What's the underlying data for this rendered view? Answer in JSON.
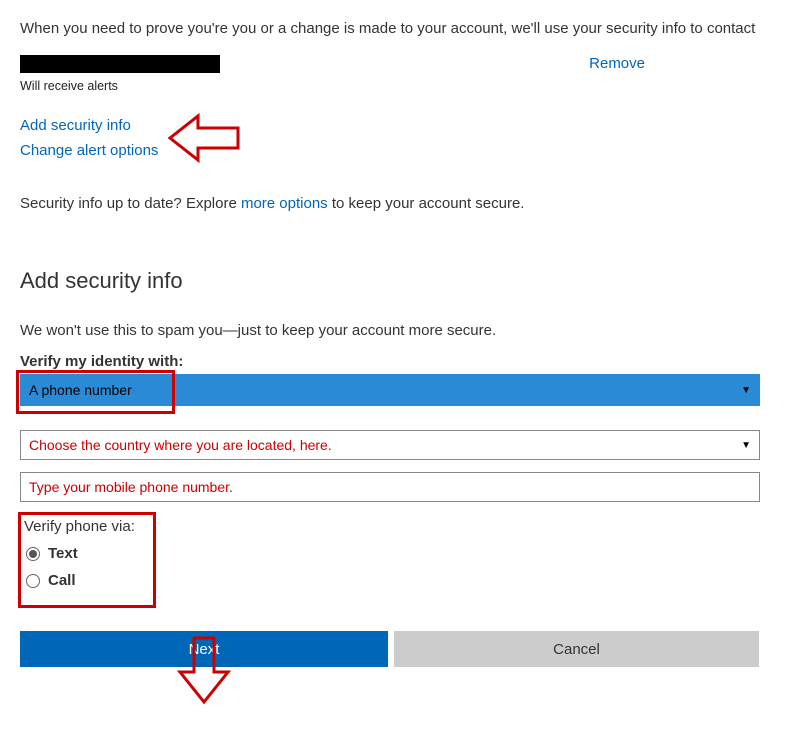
{
  "intro": "When you need to prove you're you or a change is made to your account, we'll use your security info to contact",
  "remove_label": "Remove",
  "alerts_note": "Will receive alerts",
  "links": {
    "add_security_info": "Add security info",
    "change_alert_options": "Change alert options"
  },
  "uptodate": {
    "prefix": "Security info up to date? Explore ",
    "more_options": "more options",
    "suffix": " to keep your account secure."
  },
  "section": {
    "title": "Add security info",
    "subtext": "We won't use this to spam you—just to keep your account more secure.",
    "verify_label": "Verify my identity with:",
    "identity_selected": "A phone number",
    "country_placeholder": "Choose the country where you are located, here.",
    "phone_placeholder": "Type your mobile phone number.",
    "verify_via_label": "Verify phone via:",
    "radio_text": "Text",
    "radio_call": "Call",
    "next": "Next",
    "cancel": "Cancel"
  }
}
